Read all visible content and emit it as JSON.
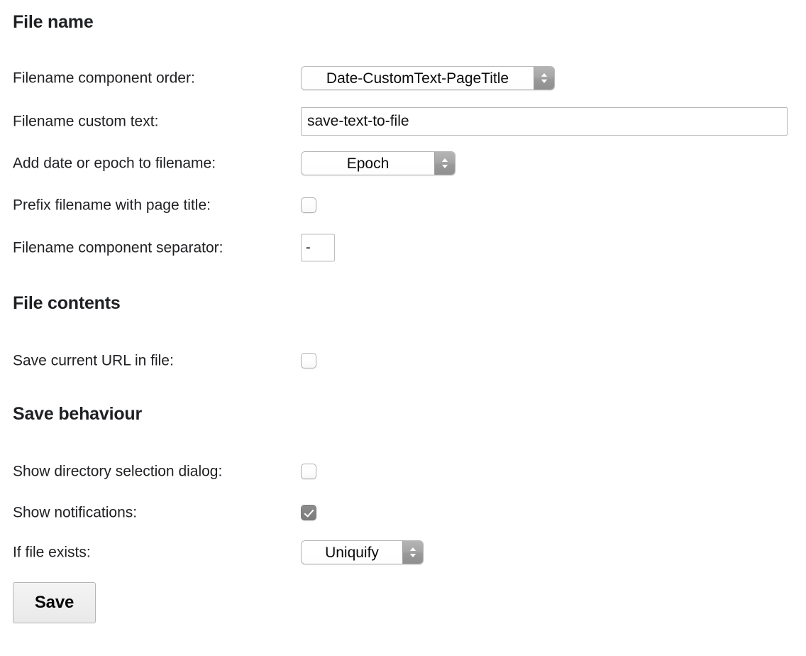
{
  "sections": {
    "file_name": {
      "heading": "File name",
      "rows": {
        "component_order": {
          "label": "Filename component order:",
          "value": "Date-CustomText-PageTitle"
        },
        "custom_text": {
          "label": "Filename custom text:",
          "value": "save-text-to-file",
          "placeholder": ""
        },
        "date_or_epoch": {
          "label": "Add date or epoch to filename:",
          "value": "Epoch"
        },
        "prefix_page_title": {
          "label": "Prefix filename with page title:",
          "checked": false
        },
        "component_separator": {
          "label": "Filename component separator:",
          "value": "-",
          "placeholder": ""
        }
      }
    },
    "file_contents": {
      "heading": "File contents",
      "rows": {
        "save_current_url": {
          "label": "Save current URL in file:",
          "checked": false
        }
      }
    },
    "save_behaviour": {
      "heading": "Save behaviour",
      "rows": {
        "show_directory_dialog": {
          "label": "Show directory selection dialog:",
          "checked": false
        },
        "show_notifications": {
          "label": "Show notifications:",
          "checked": true
        },
        "if_file_exists": {
          "label": "If file exists:",
          "value": "Uniquify"
        }
      }
    }
  },
  "actions": {
    "save_label": "Save"
  },
  "icons": {
    "select_stepper": "chevron-up-down-icon",
    "checkmark": "check-icon"
  },
  "colors": {
    "text": "#202124",
    "heading": "#1f2023",
    "checkbox_checked_fill": "#838383",
    "select_stepper_fill": "#a0a0a0",
    "border": "#b6b7b8",
    "background": "#ffffff"
  }
}
